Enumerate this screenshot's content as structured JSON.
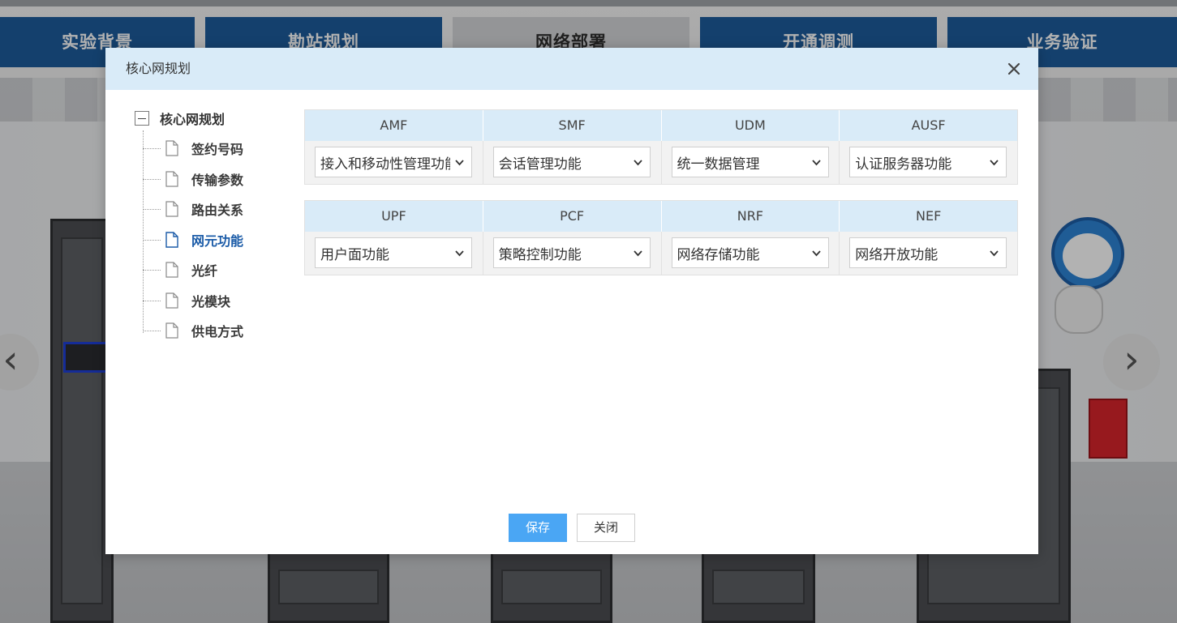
{
  "nav": {
    "tabs": [
      {
        "label": "实验背景",
        "active": false
      },
      {
        "label": "勘站规划",
        "active": false
      },
      {
        "label": "网络部署",
        "active": true
      },
      {
        "label": "开通调测",
        "active": false
      },
      {
        "label": "业务验证",
        "active": false
      }
    ]
  },
  "scene": {
    "prev_arrow": "‹",
    "next_arrow": "›"
  },
  "dialog": {
    "title": "核心网规划",
    "close_icon": "close-icon",
    "tree": {
      "root": {
        "label": "核心网规划",
        "expanded": true,
        "toggle_icon": "minus-box-icon"
      },
      "items": [
        {
          "label": "签约号码",
          "active": false,
          "icon": "document-icon"
        },
        {
          "label": "传输参数",
          "active": false,
          "icon": "document-icon"
        },
        {
          "label": "路由关系",
          "active": false,
          "icon": "document-icon"
        },
        {
          "label": "网元功能",
          "active": true,
          "icon": "document-icon"
        },
        {
          "label": "光纤",
          "active": false,
          "icon": "document-icon"
        },
        {
          "label": "光模块",
          "active": false,
          "icon": "document-icon"
        },
        {
          "label": "供电方式",
          "active": false,
          "icon": "document-icon"
        }
      ]
    },
    "grid1": {
      "headers": [
        "AMF",
        "SMF",
        "UDM",
        "AUSF"
      ],
      "values": [
        "接入和移动性管理功能",
        "会话管理功能",
        "统一数据管理",
        "认证服务器功能"
      ]
    },
    "grid2": {
      "headers": [
        "UPF",
        "PCF",
        "NRF",
        "NEF"
      ],
      "values": [
        "用户面功能",
        "策略控制功能",
        "网络存储功能",
        "网络开放功能"
      ]
    },
    "buttons": {
      "save": "保存",
      "close": "关闭"
    }
  },
  "colors": {
    "nav_tab": "#1d5c9c",
    "nav_active": "#d5d6d8",
    "header_bg": "#d9ebf8",
    "primary_button": "#4aa6f4",
    "active_tree_item": "#1c5ca8"
  }
}
